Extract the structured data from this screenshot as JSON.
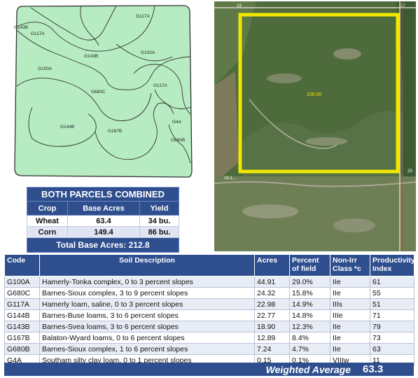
{
  "soil_map": {
    "labels": [
      "G117A",
      "G143B",
      "G117A",
      "G143B",
      "G100A",
      "G100A",
      "G680C",
      "G117A",
      "G144B",
      "G167B",
      "G4A",
      "G680B"
    ]
  },
  "aerial": {
    "acreage_label": "100.00",
    "road_labels": [
      "19",
      "17",
      "23",
      "19-1..."
    ],
    "colors": {
      "boundary": "#f2e600"
    }
  },
  "summary": {
    "title": "BOTH PARCELS COMBINED",
    "headers": [
      "Crop",
      "Base Acres",
      "Yield"
    ],
    "rows": [
      {
        "crop": "Wheat",
        "acres": "63.4",
        "yield": "34 bu."
      },
      {
        "crop": "Corn",
        "acres": "149.4",
        "yield": "86 bu."
      }
    ],
    "total": "Total Base Acres: 212.8"
  },
  "soil_table": {
    "headers": {
      "code": "Code",
      "desc": "Soil Description",
      "acres": "Acres",
      "pct": "Percent of field",
      "class": "Non-Irr Class *c",
      "pi": "Productivity Index"
    },
    "rows": [
      {
        "code": "G100A",
        "desc": "Hamerly-Tonka complex, 0 to 3 percent slopes",
        "acres": "44.91",
        "pct": "29.0%",
        "cls": "IIe",
        "pi": "61"
      },
      {
        "code": "G680C",
        "desc": "Barnes-Sioux complex, 3 to 9 percent slopes",
        "acres": "24.32",
        "pct": "15.8%",
        "cls": "IIe",
        "pi": "55"
      },
      {
        "code": "G117A",
        "desc": "Hamerly loam, saline, 0 to 3 percent slopes",
        "acres": "22.98",
        "pct": "14.9%",
        "cls": "IIIs",
        "pi": "51"
      },
      {
        "code": "G144B",
        "desc": "Barnes-Buse loams, 3 to 6 percent slopes",
        "acres": "22.77",
        "pct": "14.8%",
        "cls": "IIIe",
        "pi": "71"
      },
      {
        "code": "G143B",
        "desc": "Barnes-Svea loams, 3 to 6 percent slopes",
        "acres": "18.90",
        "pct": "12.3%",
        "cls": "IIe",
        "pi": "79"
      },
      {
        "code": "G167B",
        "desc": "Balaton-Wyard loams, 0 to 6 percent slopes",
        "acres": "12.89",
        "pct": "8.4%",
        "cls": "IIe",
        "pi": "73"
      },
      {
        "code": "G680B",
        "desc": "Barnes-Sioux complex, 1 to 6 percent slopes",
        "acres": "7.24",
        "pct": "4.7%",
        "cls": "IIe",
        "pi": "63"
      },
      {
        "code": "G4A",
        "desc": "Southam silty clay loam, 0 to 1 percent slopes",
        "acres": "0.15",
        "pct": "0.1%",
        "cls": "VIIIw",
        "pi": "11"
      }
    ],
    "weighted_label": "Weighted Average",
    "weighted_value": "63.3"
  }
}
